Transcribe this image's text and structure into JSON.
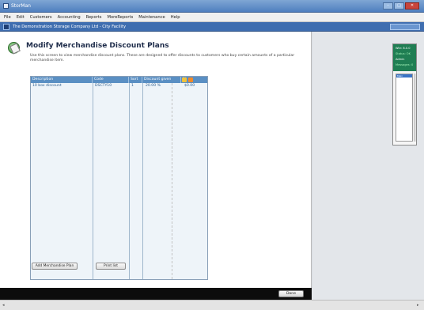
{
  "window": {
    "title": "StorMan",
    "buttons": [
      "–",
      "□",
      "✕"
    ]
  },
  "menu": [
    "File",
    "Edit",
    "Customers",
    "Accounting",
    "Reports",
    "MoreReports",
    "Maintenance",
    "Help"
  ],
  "company": {
    "name": "The Demonstration Storage Company Ltd - City Facility",
    "user_box": ""
  },
  "page": {
    "title": "Modify Merchandise Discount Plans",
    "description": "Use this screen to view merchandise discount plans. These are designed to offer discounts to customers who buy certain amounts of a particular merchandise item."
  },
  "grid": {
    "headers": [
      "Description",
      "Code",
      "Sort",
      "Discount given",
      "%",
      "£"
    ],
    "rows": [
      {
        "description": "10 box discount",
        "code": "DSCTY10",
        "sort": "1",
        "discount": "20.00 %",
        "amount": "$0.00"
      }
    ]
  },
  "buttons": {
    "add_plan": "Add Merchandise Plan",
    "print": "Print list",
    "done": "Done"
  },
  "widget": {
    "lines": [
      "Wkr: 8.0.0",
      "Status: OK",
      "Admin",
      "Messages: 0"
    ],
    "list_selected": "Main"
  },
  "colors": {
    "accent": "#5a8fc3",
    "widget_green": "#1f7e53",
    "bottom_bar": "#0c0c0c"
  },
  "icons": {
    "page": "discount-plan-icon",
    "sort_a": "sort-icon",
    "sort_b": "filter-icon"
  }
}
